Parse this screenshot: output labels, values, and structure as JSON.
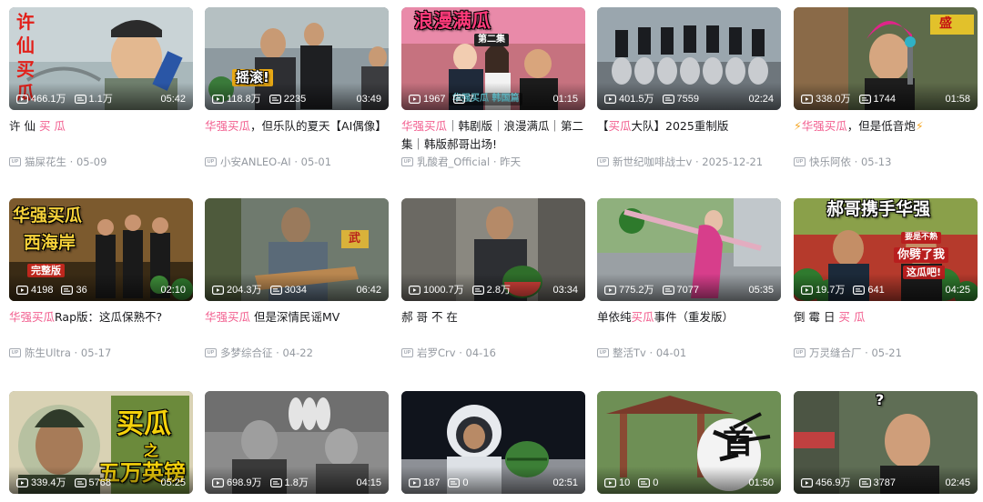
{
  "rows": [
    [
      {
        "overlay": [
          "许",
          "仙",
          "买",
          "瓜"
        ],
        "views": "466.1万",
        "danmaku": "1.1万",
        "duration": "05:42",
        "title_parts": [
          {
            "t": "许 仙 "
          },
          {
            "t": "买 瓜",
            "hl": true
          }
        ],
        "author": "猫屎花生",
        "date": "05-09"
      },
      {
        "overlay": [
          "摇滚!"
        ],
        "views": "118.8万",
        "danmaku": "2235",
        "duration": "03:49",
        "title_parts": [
          {
            "t": "华强买瓜",
            "hl": true
          },
          {
            "t": "，但乐队的夏天【AI偶像】"
          }
        ],
        "author": "小安ANLEO-AI",
        "date": "05-01"
      },
      {
        "overlay": [
          "浪漫满瓜",
          "第二集",
          "华强买瓜 韩国篇"
        ],
        "views": "1967",
        "danmaku": "7",
        "duration": "01:15",
        "title_parts": [
          {
            "t": "华强买瓜",
            "hl": true
          },
          {
            "t": "｜韩剧版｜浪漫满瓜｜第二集｜韩版郝哥出场!"
          }
        ],
        "author": "乳酸君_Official",
        "date": "昨天"
      },
      {
        "overlay": [],
        "views": "401.5万",
        "danmaku": "7559",
        "duration": "02:24",
        "title_parts": [
          {
            "t": "【"
          },
          {
            "t": "买瓜",
            "hl": true
          },
          {
            "t": "大队】2025重制版"
          }
        ],
        "author": "新世纪咖啡战士v",
        "date": "2025-12-21"
      },
      {
        "overlay": [
          "盛"
        ],
        "views": "338.0万",
        "danmaku": "1744",
        "duration": "01:58",
        "title_parts": [
          {
            "t": "⚡",
            "bolt": true
          },
          {
            "t": "华强买瓜",
            "hl": true
          },
          {
            "t": "，但是低音炮"
          },
          {
            "t": "⚡",
            "bolt": true
          }
        ],
        "author": "快乐阿依",
        "date": "05-13"
      }
    ],
    [
      {
        "overlay": [
          "华强买瓜",
          "西海岸",
          "完整版"
        ],
        "views": "4198",
        "danmaku": "36",
        "duration": "02:10",
        "title_parts": [
          {
            "t": "华强买瓜",
            "hl": true
          },
          {
            "t": "Rap版：这瓜保熟不?"
          }
        ],
        "author": "陈生Ultra",
        "date": "05-17"
      },
      {
        "overlay": [
          "武"
        ],
        "views": "204.3万",
        "danmaku": "3034",
        "duration": "06:42",
        "title_parts": [
          {
            "t": "华强买瓜",
            "hl": true
          },
          {
            "t": " 但是深情民谣MV"
          }
        ],
        "author": "多梦综合征",
        "date": "04-22"
      },
      {
        "overlay": [],
        "views": "1000.7万",
        "danmaku": "2.8万",
        "duration": "03:34",
        "title_parts": [
          {
            "t": "郝 哥 不 在"
          }
        ],
        "author": "岩罗Crv",
        "date": "04-16"
      },
      {
        "overlay": [],
        "views": "775.2万",
        "danmaku": "7077",
        "duration": "05:35",
        "title_parts": [
          {
            "t": "单依纯"
          },
          {
            "t": "买瓜",
            "hl": true
          },
          {
            "t": "事件（重发版）"
          }
        ],
        "author": "整活Tv",
        "date": "04-01"
      },
      {
        "overlay": [
          "郝哥携手华强",
          "要是不熟",
          "你劈了我",
          "这瓜吧!"
        ],
        "views": "19.7万",
        "danmaku": "641",
        "duration": "04:25",
        "title_parts": [
          {
            "t": "倒 霉 日 "
          },
          {
            "t": "买 瓜",
            "hl": true
          }
        ],
        "author": "万灵缝合厂",
        "date": "05-21"
      }
    ],
    [
      {
        "overlay": [
          "买瓜",
          "之",
          "五万英镑"
        ],
        "views": "339.4万",
        "danmaku": "5768",
        "duration": "05:25"
      },
      {
        "overlay": [],
        "views": "698.9万",
        "danmaku": "1.8万",
        "duration": "04:15"
      },
      {
        "overlay": [],
        "views": "187",
        "danmaku": "0",
        "duration": "02:51"
      },
      {
        "overlay": [
          "首"
        ],
        "views": "10",
        "danmaku": "0",
        "duration": "01:50"
      },
      {
        "overlay": [
          "?"
        ],
        "views": "456.9万",
        "danmaku": "3787",
        "duration": "02:45"
      }
    ]
  ],
  "icons": {
    "play": "play-count-icon",
    "danmaku": "danmaku-count-icon",
    "up": "uploader-badge-icon"
  },
  "up_badge": "UP",
  "colors": {
    "highlight": "#f25d8e",
    "meta": "#9499a0",
    "text": "#18191c"
  }
}
